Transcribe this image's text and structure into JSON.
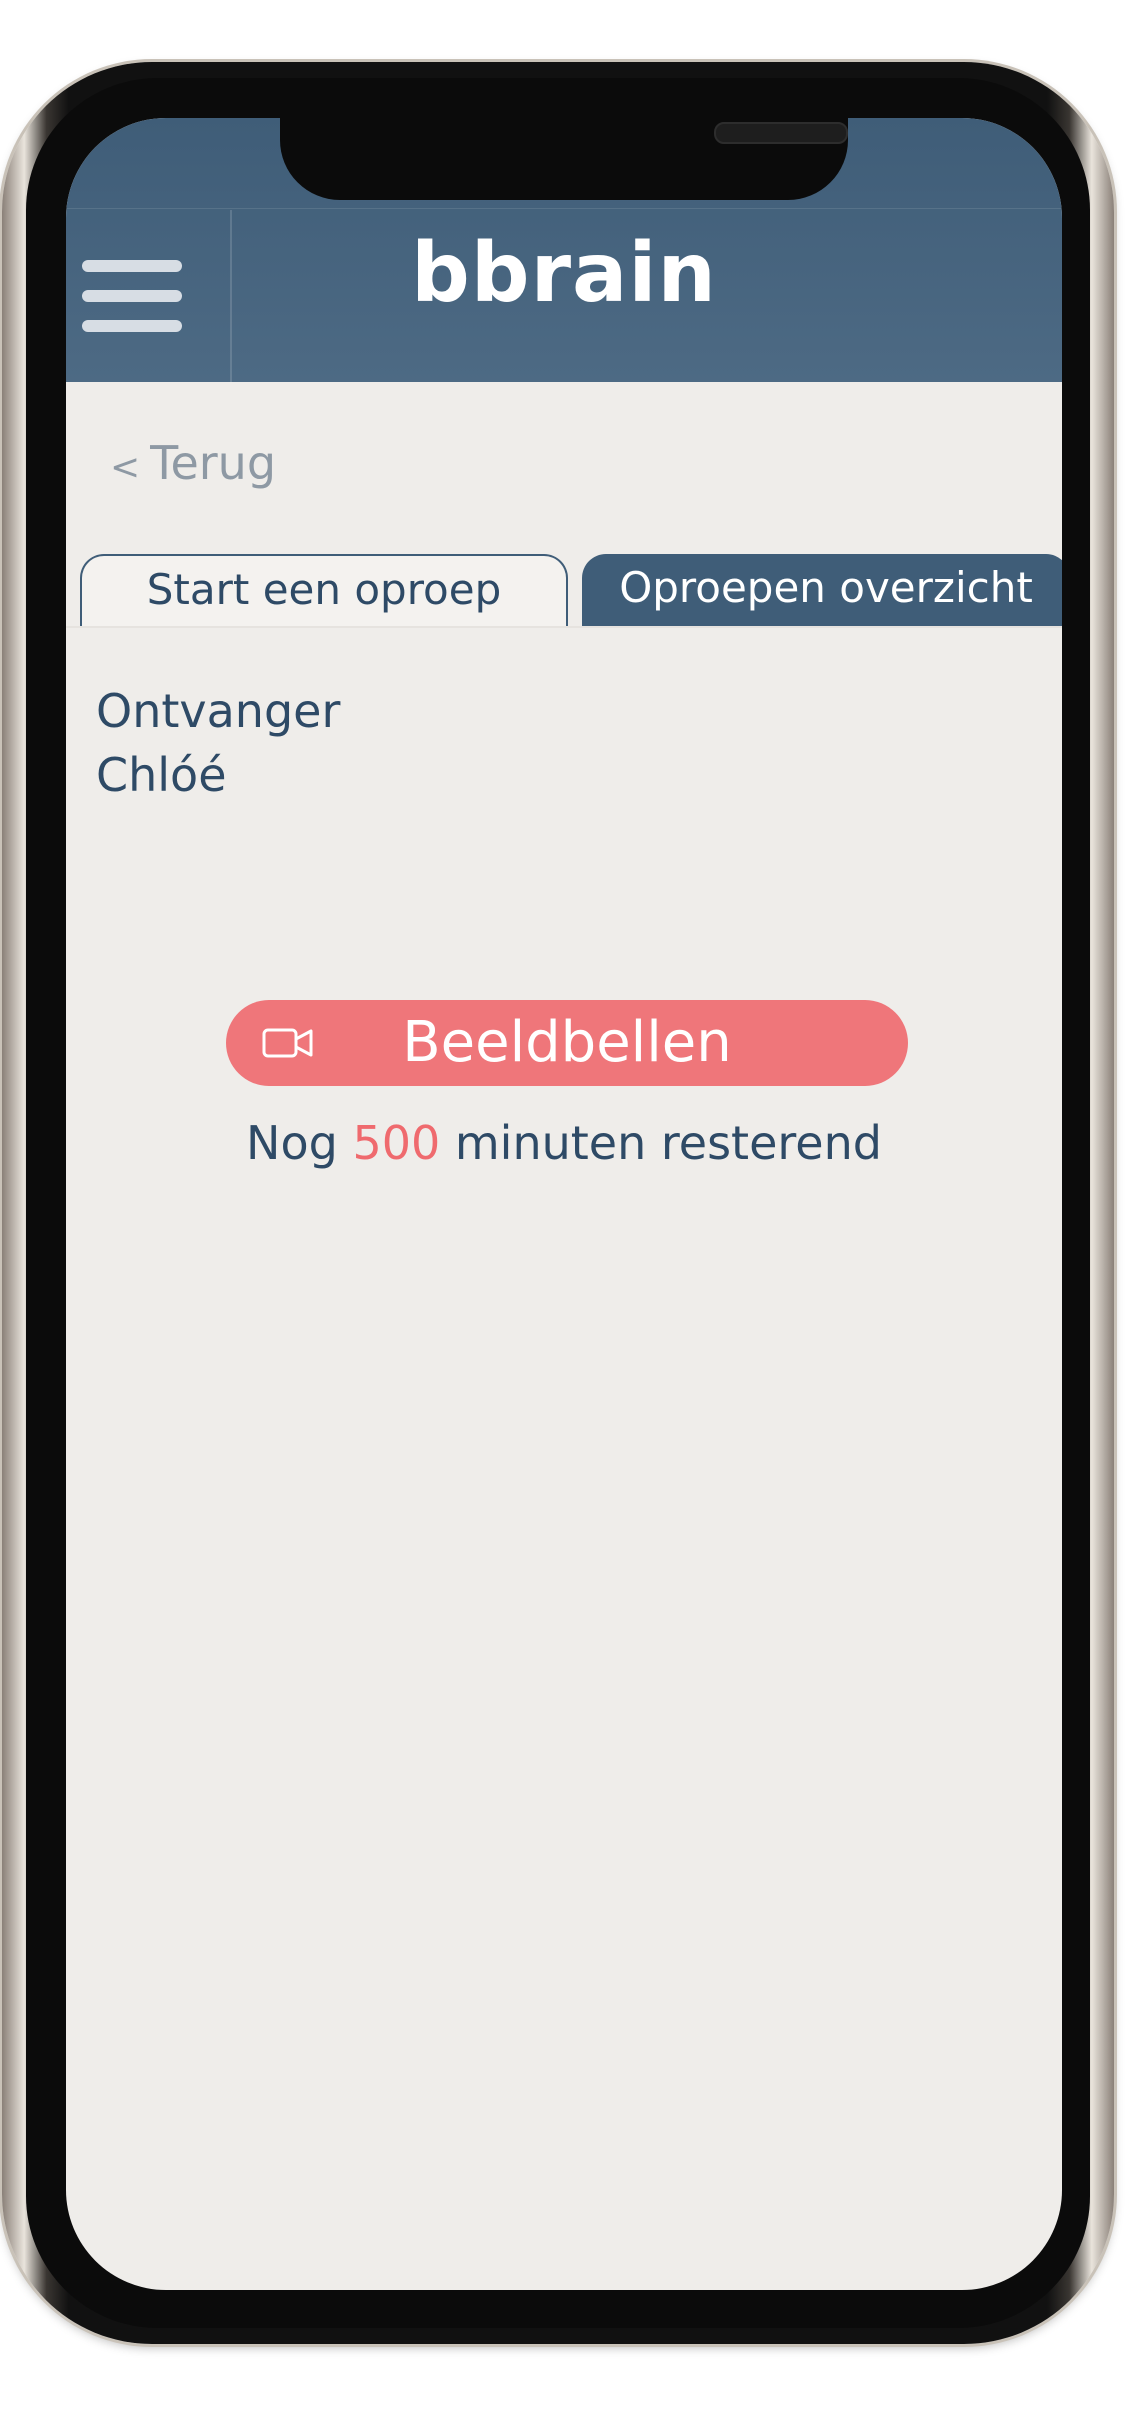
{
  "app": {
    "logo_text": "bbrain"
  },
  "nav": {
    "back_label": "Terug",
    "back_chevron": "<"
  },
  "tabs": [
    {
      "label": "Start een oproep",
      "active": true
    },
    {
      "label": "Oproepen overzicht",
      "active": false
    }
  ],
  "recipient": {
    "label": "Ontvanger",
    "name": "Chlóé"
  },
  "call": {
    "button_label": "Beeldbellen",
    "icon": "video-camera-icon"
  },
  "remaining": {
    "prefix": "Nog",
    "minutes": "500",
    "suffix": "minuten resterend"
  },
  "colors": {
    "header": "#3f5d78",
    "accent": "#ef767a",
    "text_primary": "#2e4a66",
    "background": "#efedea"
  }
}
